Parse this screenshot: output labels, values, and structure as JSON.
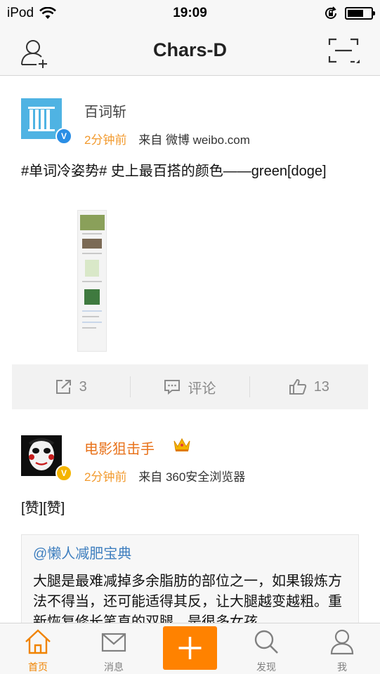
{
  "status_bar": {
    "carrier": "iPod",
    "time": "19:09"
  },
  "nav": {
    "title": "Chars-D"
  },
  "posts": [
    {
      "user": "百词斩",
      "time": "2分钟前",
      "source_prefix": "来自",
      "source": "微博 weibo.com",
      "text": "#单词冷姿势# 史上最百搭的颜色——green[doge]",
      "actions": {
        "repost_count": "3",
        "comment_label": "评论",
        "like_count": "13"
      }
    },
    {
      "user": "电影狙击手",
      "time": "2分钟前",
      "source_prefix": "来自",
      "source": "360安全浏览器",
      "text": "[赞][赞]",
      "repost": {
        "user": "@懒人减肥宝典",
        "text": "大腿是最难减掉多余脂肪的部位之一，如果锻炼方法不得当，还可能适得其反，让大腿越变越粗。重新恢复修长笔直的双腿，是很多女孩"
      }
    }
  ],
  "tabs": [
    {
      "label": "首页",
      "icon": "home-icon",
      "active": true
    },
    {
      "label": "消息",
      "icon": "message-icon",
      "active": false
    },
    {
      "label": "",
      "icon": "plus-icon",
      "active": false
    },
    {
      "label": "发现",
      "icon": "search-icon",
      "active": false
    },
    {
      "label": "我",
      "icon": "profile-icon",
      "active": false
    }
  ],
  "colors": {
    "accent": "#ff8200",
    "time": "#f29a2e",
    "vip_name": "#e8731c",
    "link": "#3f7fbf",
    "verify_blue": "#2b8ee5",
    "verify_gold": "#f4b400"
  }
}
